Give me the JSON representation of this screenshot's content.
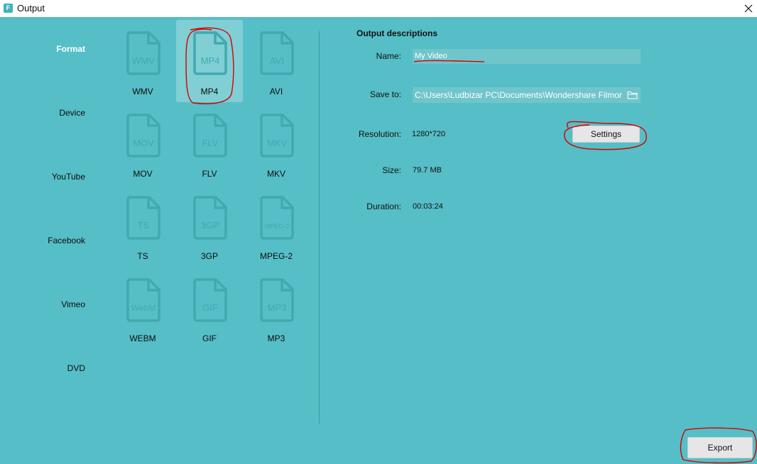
{
  "window": {
    "title": "Output",
    "app_icon_letter": "F"
  },
  "sidebar": {
    "items": [
      {
        "label": "Format",
        "active": true
      },
      {
        "label": "Device",
        "active": false
      },
      {
        "label": "YouTube",
        "active": false
      },
      {
        "label": "Facebook",
        "active": false
      },
      {
        "label": "Vimeo",
        "active": false
      },
      {
        "label": "DVD",
        "active": false
      }
    ]
  },
  "formats": [
    {
      "icon_text": "WMV",
      "label": "WMV",
      "selected": false
    },
    {
      "icon_text": "MP4",
      "label": "MP4",
      "selected": true
    },
    {
      "icon_text": "AVI",
      "label": "AVI",
      "selected": false
    },
    {
      "icon_text": "MOV",
      "label": "MOV",
      "selected": false
    },
    {
      "icon_text": "FLV",
      "label": "FLV",
      "selected": false
    },
    {
      "icon_text": "MKV",
      "label": "MKV",
      "selected": false
    },
    {
      "icon_text": "TS",
      "label": "TS",
      "selected": false
    },
    {
      "icon_text": "3GP",
      "label": "3GP",
      "selected": false
    },
    {
      "icon_text": "MPEG-2",
      "label": "MPEG-2",
      "selected": false
    },
    {
      "icon_text": "WebM",
      "label": "WEBM",
      "selected": false
    },
    {
      "icon_text": "GIF",
      "label": "GIF",
      "selected": false
    },
    {
      "icon_text": "MP3",
      "label": "MP3",
      "selected": false
    }
  ],
  "output": {
    "section_title": "Output descriptions",
    "name_label": "Name:",
    "name_value": "My Video",
    "save_label": "Save to:",
    "save_value": "C:\\Users\\Ludbizar PC\\Documents\\Wondershare Filmor",
    "resolution_label": "Resolution:",
    "resolution_value": "1280*720",
    "settings_button": "Settings",
    "size_label": "Size:",
    "size_value": "79.7 MB",
    "duration_label": "Duration:",
    "duration_value": "00:03:24"
  },
  "footer": {
    "export_button": "Export"
  },
  "colors": {
    "background": "#56bec6",
    "tile_selected": "#7fcfd5",
    "input_bg": "#70c5cb",
    "annotation": "#d40000"
  }
}
